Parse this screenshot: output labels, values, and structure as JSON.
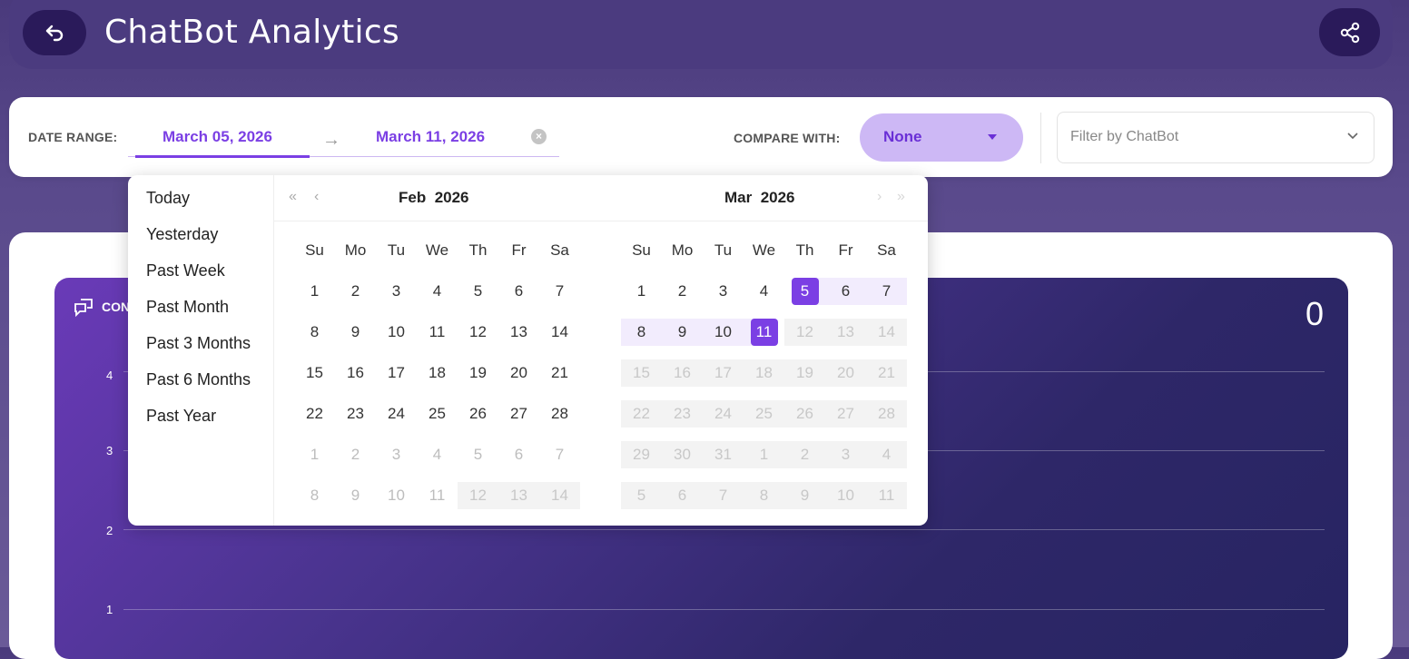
{
  "app": {
    "title": "ChatBot Analytics"
  },
  "filters": {
    "date_range_label": "DATE RANGE:",
    "start_date": "March 05, 2026",
    "end_date": "March 11, 2026",
    "compare_label": "COMPARE WITH:",
    "compare_value": "None",
    "chatbot_placeholder": "Filter by ChatBot"
  },
  "stat": {
    "label": "CON",
    "value": "0"
  },
  "chart_data": {
    "type": "line",
    "yticks": [
      "4",
      "3",
      "2",
      "1"
    ],
    "ylim": [
      0,
      4
    ],
    "grid": true,
    "series": []
  },
  "presets": [
    "Today",
    "Yesterday",
    "Past Week",
    "Past Month",
    "Past 3 Months",
    "Past 6 Months",
    "Past Year"
  ],
  "calendar": {
    "weekdays": [
      "Su",
      "Mo",
      "Tu",
      "We",
      "Th",
      "Fr",
      "Sa"
    ],
    "left_month": "Feb",
    "left_year": "2026",
    "right_month": "Mar",
    "right_year": "2026",
    "left_weeks": [
      [
        "1",
        "2",
        "3",
        "4",
        "5",
        "6",
        "7"
      ],
      [
        "8",
        "9",
        "10",
        "11",
        "12",
        "13",
        "14"
      ],
      [
        "15",
        "16",
        "17",
        "18",
        "19",
        "20",
        "21"
      ],
      [
        "22",
        "23",
        "24",
        "25",
        "26",
        "27",
        "28"
      ],
      [
        "1",
        "2",
        "3",
        "4",
        "5",
        "6",
        "7"
      ],
      [
        "8",
        "9",
        "10",
        "11",
        "12",
        "13",
        "14"
      ]
    ],
    "right_weeks": [
      [
        "1",
        "2",
        "3",
        "4",
        "5",
        "6",
        "7"
      ],
      [
        "8",
        "9",
        "10",
        "11",
        "12",
        "13",
        "14"
      ],
      [
        "15",
        "16",
        "17",
        "18",
        "19",
        "20",
        "21"
      ],
      [
        "22",
        "23",
        "24",
        "25",
        "26",
        "27",
        "28"
      ],
      [
        "29",
        "30",
        "31",
        "1",
        "2",
        "3",
        "4"
      ],
      [
        "5",
        "6",
        "7",
        "8",
        "9",
        "10",
        "11"
      ]
    ],
    "selected_start": "5",
    "selected_end": "11"
  },
  "colors": {
    "accent": "#7b3fe4",
    "range": "#f2ecfd",
    "header": "#4b3b7f"
  }
}
